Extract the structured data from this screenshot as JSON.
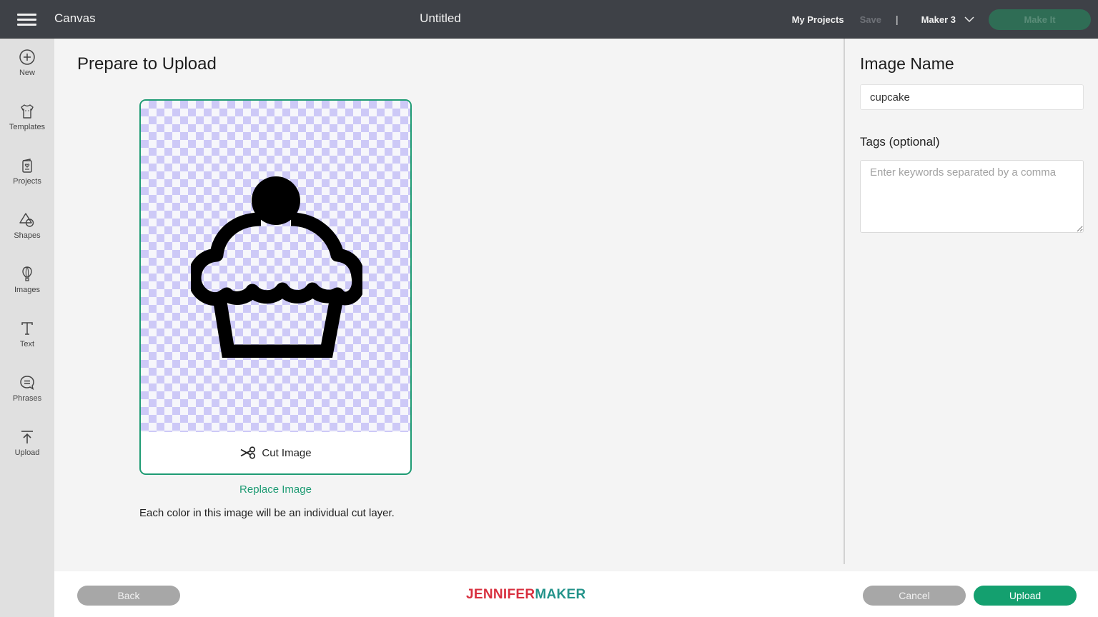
{
  "topbar": {
    "menu_icon": "hamburger-menu-icon",
    "app_title": "Canvas",
    "document_title": "Untitled",
    "my_projects_label": "My Projects",
    "save_label": "Save",
    "separator": "|",
    "machine_label": "Maker 3",
    "machine_icon": "chevron-down-icon",
    "make_it_label": "Make It"
  },
  "sidebar": {
    "items": [
      {
        "label": "New",
        "icon": "plus-circle-icon"
      },
      {
        "label": "Templates",
        "icon": "tshirt-icon"
      },
      {
        "label": "Projects",
        "icon": "project-card-icon"
      },
      {
        "label": "Shapes",
        "icon": "shapes-icon"
      },
      {
        "label": "Images",
        "icon": "hot-air-balloon-icon"
      },
      {
        "label": "Text",
        "icon": "text-icon"
      },
      {
        "label": "Phrases",
        "icon": "speech-bubble-icon"
      },
      {
        "label": "Upload",
        "icon": "upload-icon"
      }
    ]
  },
  "main": {
    "title": "Prepare to Upload",
    "preview_image": "cupcake-icon",
    "cut_image_label": "Cut Image",
    "cut_image_icon": "scissors-icon",
    "replace_image_label": "Replace Image",
    "info_text": "Each color in this image will be an individual cut layer."
  },
  "right_panel": {
    "image_name_heading": "Image Name",
    "image_name_value": "cupcake",
    "tags_label": "Tags (optional)",
    "tags_placeholder": "Enter keywords separated by a comma",
    "tags_value": ""
  },
  "footer": {
    "back_label": "Back",
    "brand_part1": "JENNIFER",
    "brand_part2": "MAKER",
    "cancel_label": "Cancel",
    "upload_label": "Upload"
  },
  "colors": {
    "accent_green": "#14a06f",
    "topbar_bg": "#3e4147",
    "sidebar_bg": "#e0e0e0",
    "checker_purple": "#cdc9f7",
    "brand_red": "#d8303f",
    "brand_teal": "#23938a"
  }
}
